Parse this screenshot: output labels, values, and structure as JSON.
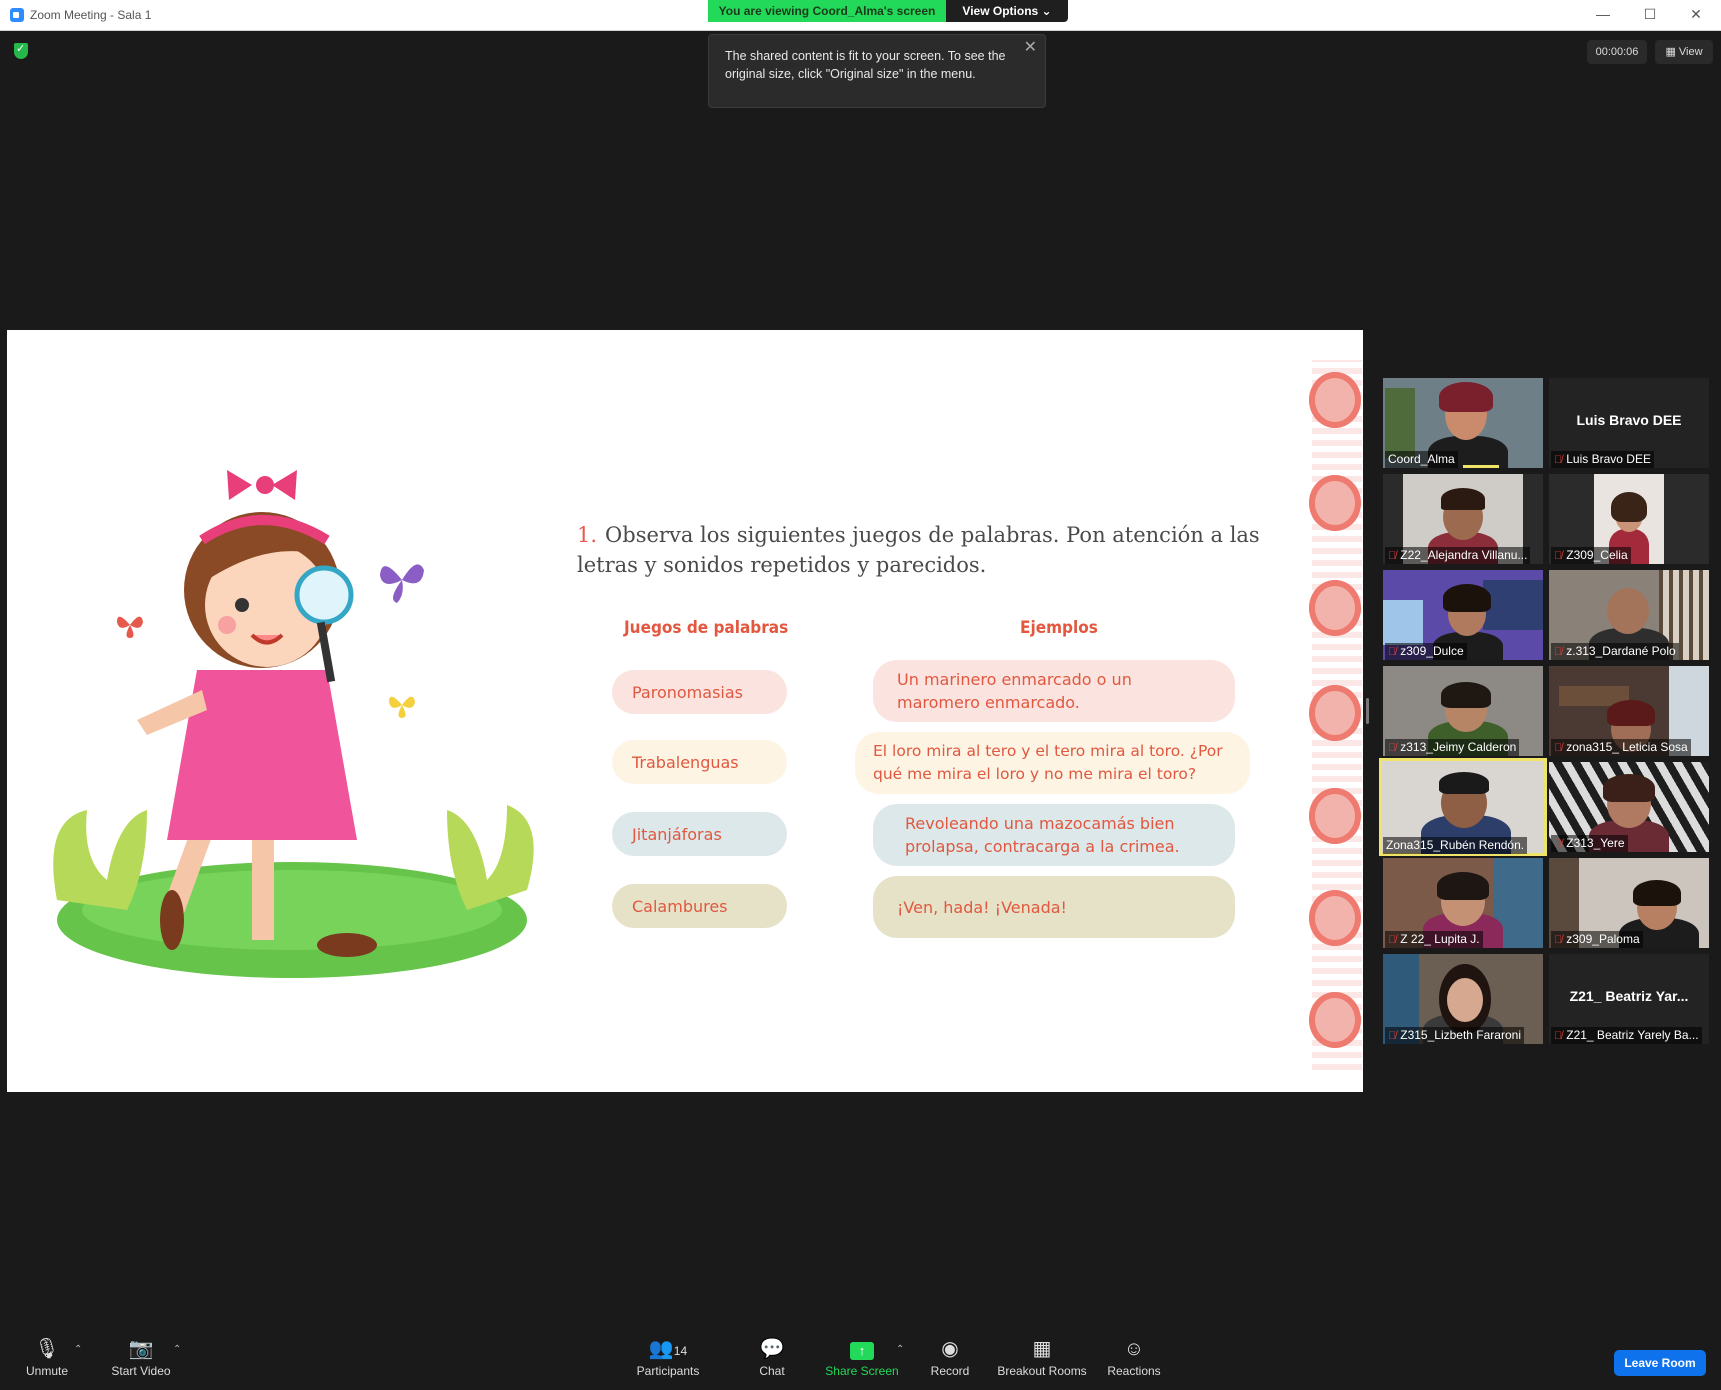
{
  "window": {
    "title": "Zoom Meeting - Sala 1",
    "minimize": "—",
    "maximize": "☐",
    "close": "✕"
  },
  "banner": {
    "viewing": "You are viewing Coord_Alma's screen",
    "view_options": "View Options ⌄"
  },
  "tooltip": {
    "text": "The shared content is fit to your screen. To see the original size, click \"Original size\" in the menu.",
    "close": "✕"
  },
  "meeting": {
    "timer": "00:00:06",
    "view_label": "View"
  },
  "slide": {
    "question_number": "1.",
    "question_text": "Observa los siguientes juegos de palabras. Pon atención a las letras y sonidos repetidos y parecidos.",
    "col_left_header": "Juegos de palabras",
    "col_right_header": "Ejemplos",
    "rows": [
      {
        "juego": "Paronomasias",
        "ejemplo": "Un marinero enmarcado o un maromero enmarcado.",
        "color": "#fbe3e0"
      },
      {
        "juego": "Trabalenguas",
        "ejemplo": "El loro mira al tero y el tero mira al toro. ¿Por qué me mira el loro y no me mira el toro?",
        "color": "#fdf4e4"
      },
      {
        "juego": "Jitanjáforas",
        "ejemplo": "Revoleando una mazocamás bien prolapsa, contracarga a la crimea.",
        "color": "#dde8ea"
      },
      {
        "juego": "Calambures",
        "ejemplo": "¡Ven, hada! ¡Venada!",
        "color": "#e6e2c8"
      }
    ]
  },
  "participants": [
    {
      "name": "Coord_Alma",
      "video": true,
      "muted": false
    },
    {
      "name": "Luis Bravo DEE",
      "display_name": "Luis Bravo DEE",
      "video": false,
      "muted": true
    },
    {
      "name": "Z22_Alejandra Villanu...",
      "video": true,
      "muted": true
    },
    {
      "name": "Z309_Celia",
      "video": true,
      "muted": true
    },
    {
      "name": "z309_Dulce",
      "video": true,
      "muted": true
    },
    {
      "name": "z.313_Dardané Polo",
      "video": true,
      "muted": true
    },
    {
      "name": "z313_Jeimy Calderon",
      "video": true,
      "muted": true
    },
    {
      "name": "zona315_ Leticia Sosa",
      "video": true,
      "muted": true
    },
    {
      "name": "Zona315_Rubén Rendón.",
      "video": true,
      "muted": false,
      "active_speaker": true
    },
    {
      "name": "Z313_Yere",
      "video": true,
      "muted": true
    },
    {
      "name": "Z 22_ Lupita J.",
      "video": true,
      "muted": true
    },
    {
      "name": "z309_Paloma",
      "video": true,
      "muted": true
    },
    {
      "name": "Z315_Lizbeth Fararoni",
      "video": true,
      "muted": true
    },
    {
      "name": "Z21_ Beatriz Yarely Ba...",
      "display_name": "Z21_ Beatriz Yar...",
      "video": false,
      "muted": true
    }
  ],
  "toolbar": {
    "unmute": "Unmute",
    "start_video": "Start Video",
    "participants": "Participants",
    "participants_count": "14",
    "chat": "Chat",
    "share_screen": "Share Screen",
    "record": "Record",
    "breakout_rooms": "Breakout Rooms",
    "reactions": "Reactions",
    "leave_room": "Leave Room"
  },
  "colors": {
    "accent_green": "#23d959",
    "leave_blue": "#0e72ed",
    "mute_red": "#e03e3e",
    "slide_text_red": "#e0583f"
  }
}
